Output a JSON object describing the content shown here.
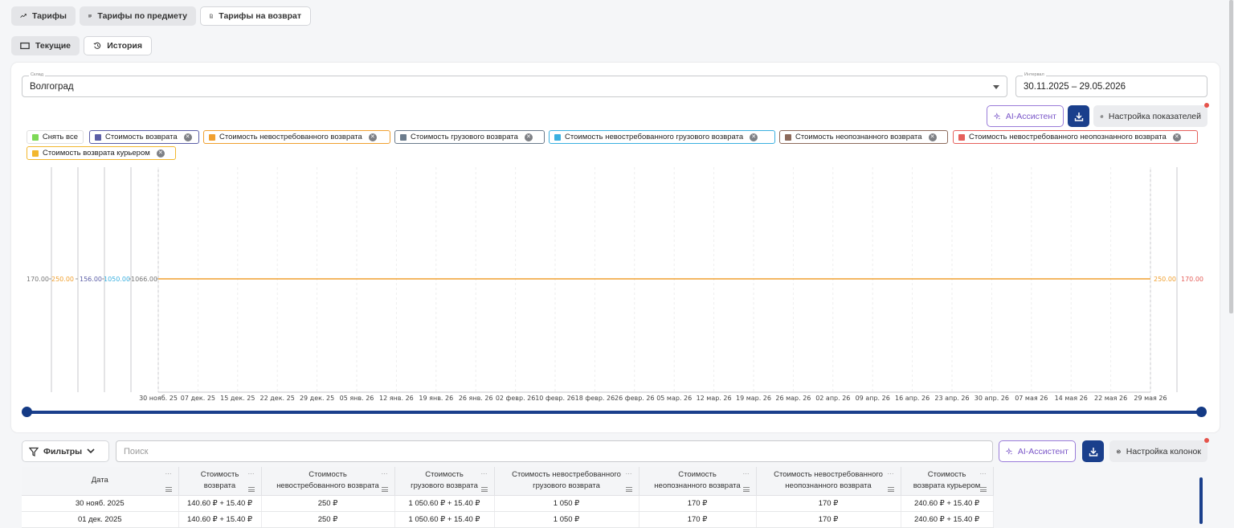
{
  "tabs": {
    "tariffs": "Тарифы",
    "by_subject": "Тарифы по предмету",
    "returns": "Тарифы на возврат"
  },
  "subtabs": {
    "current": "Текущие",
    "history": "История"
  },
  "warehouse": {
    "label": "Склад",
    "value": "Волгоград"
  },
  "interval": {
    "label": "Интервал",
    "value": "30.11.2025 – 29.05.2026"
  },
  "chart_toolbar": {
    "ai": "AI-Ассистент",
    "settings": "Настройка показателей"
  },
  "legend_chips": {
    "clear_all": "Снять все",
    "items": [
      {
        "label": "Стоимость возврата",
        "color": "#5b5ea6"
      },
      {
        "label": "Стоимость невостребованного возврата",
        "color": "#f0a030"
      },
      {
        "label": "Стоимость грузового возврата",
        "color": "#6b7b8c"
      },
      {
        "label": "Стоимость невостребованного грузового возврата",
        "color": "#3ab0e0"
      },
      {
        "label": "Стоимость неопознанного возврата",
        "color": "#8c6a5b"
      },
      {
        "label": "Стоимость невостребованного неопознанного возврата",
        "color": "#e5605b"
      },
      {
        "label": "Стоимость возврата курьером",
        "color": "#f2b72e"
      }
    ],
    "clear_color": "#7ed957"
  },
  "chart_data": {
    "type": "line",
    "title": "",
    "x": [
      "30 нояб. 25",
      "07 дек. 25",
      "15 дек. 25",
      "22 дек. 25",
      "29 дек. 25",
      "05 янв. 26",
      "12 янв. 26",
      "19 янв. 26",
      "26 янв. 26",
      "02 февр. 26",
      "10 февр. 26",
      "18 февр. 26",
      "26 февр. 26",
      "05 мар. 26",
      "12 мар. 26",
      "19 мар. 26",
      "26 мар. 26",
      "02 апр. 26",
      "09 апр. 26",
      "16 апр. 26",
      "23 апр. 26",
      "30 апр. 26",
      "07 мая 26",
      "14 мая 26",
      "22 мая 26",
      "29 мая 26"
    ],
    "left_axes": [
      {
        "label": "170.00",
        "color": "#777777"
      },
      {
        "label": "250.00",
        "color": "#f0a030"
      },
      {
        "label": "156.00",
        "color": "#5b5ea6"
      },
      {
        "label": "1050.00",
        "color": "#3ab0e0"
      },
      {
        "label": "1066.00",
        "color": "#777777"
      }
    ],
    "right_axes": [
      {
        "label": "250.00",
        "color": "#f0a030"
      },
      {
        "label": "170.00",
        "color": "#e5605b"
      }
    ],
    "series": [
      {
        "name": "Стоимость невостребованного возврата",
        "color": "#f0a030",
        "values_constant": 250
      }
    ]
  },
  "range_slider": {
    "start": 0,
    "end": 1
  },
  "table_toolbar": {
    "filters": "Фильтры",
    "search_placeholder": "Поиск",
    "ai": "AI-Ассистент",
    "settings": "Настройка колонок"
  },
  "table": {
    "headers": [
      [
        "Дата"
      ],
      [
        "Стоимость",
        "возврата"
      ],
      [
        "Стоимость",
        "невостребованного возврата"
      ],
      [
        "Стоимость",
        "грузового возврата"
      ],
      [
        "Стоимость невостребованного",
        "грузового возврата"
      ],
      [
        "Стоимость",
        "неопознанного возврата"
      ],
      [
        "Стоимость невостребованного",
        "неопознанного возврата"
      ],
      [
        "Стоимость",
        "возврата курьером"
      ]
    ],
    "rows": [
      [
        "30 нояб. 2025",
        "140.60 ₽ + 15.40 ₽",
        "250 ₽",
        "1 050.60 ₽ + 15.40 ₽",
        "1 050 ₽",
        "170 ₽",
        "170 ₽",
        "240.60 ₽ + 15.40 ₽"
      ],
      [
        "01 дек. 2025",
        "140.60 ₽ + 15.40 ₽",
        "250 ₽",
        "1 050.60 ₽ + 15.40 ₽",
        "1 050 ₽",
        "170 ₽",
        "170 ₽",
        "240.60 ₽ + 15.40 ₽"
      ]
    ]
  }
}
